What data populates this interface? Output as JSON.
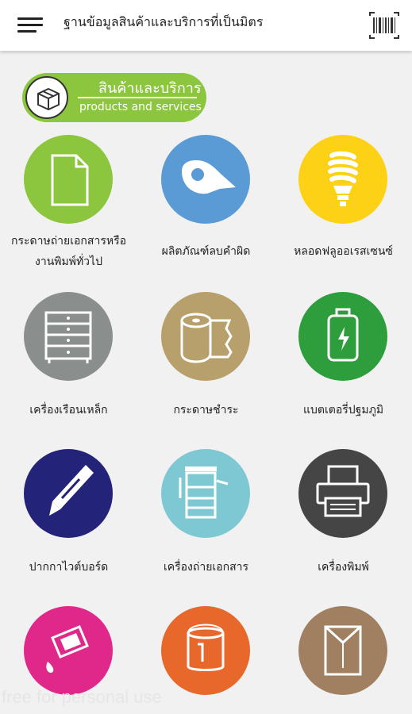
{
  "header": {
    "title": "ฐานข้อมูลสินค้าและบริการที่เป็นมิตร",
    "menu_icon": "hamburger-menu-icon",
    "barcode_icon": "barcode-scan-icon"
  },
  "section": {
    "title_th": "สินค้าและบริการ",
    "title_en": "products and services",
    "icon": "box-icon",
    "color": "#8cc63f"
  },
  "categories": [
    {
      "label_line1": "กระดาษถ่ายเอกสารหรือ",
      "label_line2": "งานพิมพ์ทั่วไป",
      "icon": "document-icon",
      "color": "#8cc63f"
    },
    {
      "label_line1": "",
      "label_line2": "ผลิตภัณฑ์ลบคำผิด",
      "icon": "correction-tape-icon",
      "color": "#5b9bd5"
    },
    {
      "label_line1": "",
      "label_line2": "หลอดฟลูออเรสเซนซ์",
      "icon": "cfl-bulb-icon",
      "color": "#fcd116"
    },
    {
      "label_line1": "",
      "label_line2": "เครื่องเรือนเหล็ก",
      "icon": "steel-cabinet-icon",
      "color": "#8a8e8c"
    },
    {
      "label_line1": "",
      "label_line2": "กระดาษชำระ",
      "icon": "toilet-paper-icon",
      "color": "#b7a06c"
    },
    {
      "label_line1": "",
      "label_line2": "แบตเตอรี่ปฐมภูมิ",
      "icon": "battery-icon",
      "color": "#2e9e3c"
    },
    {
      "label_line1": "",
      "label_line2": "ปากกาไวต์บอร์ด",
      "icon": "pen-icon",
      "color": "#24237a"
    },
    {
      "label_line1": "",
      "label_line2": "เครื่องถ่ายเอกสาร",
      "icon": "photocopier-icon",
      "color": "#7ec8d3"
    },
    {
      "label_line1": "",
      "label_line2": "เครื่องพิมพ์",
      "icon": "printer-icon",
      "color": "#454545"
    },
    {
      "label_line1": "",
      "label_line2": "",
      "icon": "paint-brush-icon",
      "color": "#e0288a"
    },
    {
      "label_line1": "",
      "label_line2": "",
      "icon": "paint-can-icon",
      "color": "#e8682c"
    },
    {
      "label_line1": "",
      "label_line2": "",
      "icon": "envelope-icon",
      "color": "#a08060"
    }
  ],
  "watermark": "free for personal use"
}
